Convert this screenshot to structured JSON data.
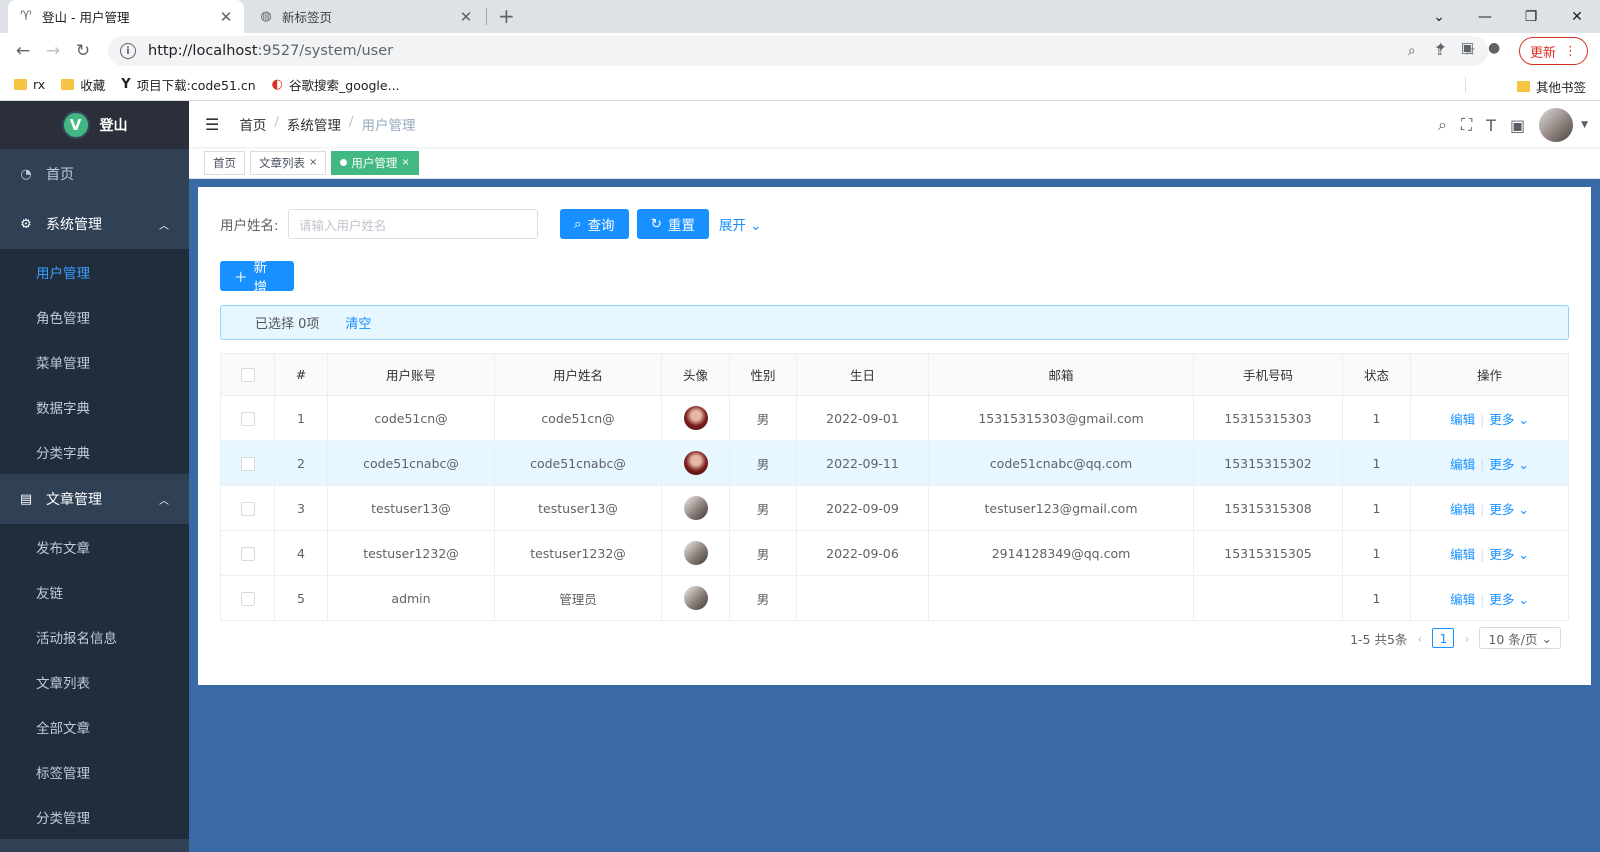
{
  "browser": {
    "tabs": [
      {
        "title": "登山 - 用户管理",
        "icon": "mountain-icon"
      },
      {
        "title": "新标签页",
        "icon": "globe-icon"
      }
    ],
    "url_host": "http://localhost",
    "url_path": ":9527/system/user",
    "update_label": "更新",
    "bookmarks": [
      "rx",
      "收藏",
      "项目下载:code51.cn",
      "谷歌搜索_google..."
    ],
    "other_bookmarks": "其他书签"
  },
  "sidebar": {
    "logo_letter": "V",
    "logo_text": "登山",
    "items": [
      {
        "label": "首页",
        "icon": "dashboard-icon"
      },
      {
        "label": "系统管理",
        "icon": "gear-icon",
        "children": [
          "用户管理",
          "角色管理",
          "菜单管理",
          "数据字典",
          "分类字典"
        ]
      },
      {
        "label": "文章管理",
        "icon": "document-icon",
        "children": [
          "发布文章",
          "友链",
          "活动报名信息",
          "文章列表",
          "全部文章",
          "标签管理",
          "分类管理"
        ]
      }
    ]
  },
  "breadcrumb": [
    "首页",
    "系统管理",
    "用户管理"
  ],
  "tags": [
    "首页",
    "文章列表",
    "用户管理"
  ],
  "search": {
    "label": "用户姓名:",
    "placeholder": "请输入用户姓名",
    "query": "查询",
    "reset": "重置",
    "expand": "展开"
  },
  "add_label": "新增",
  "alert": {
    "selected": "已选择 0项",
    "clear": "清空"
  },
  "table": {
    "columns": [
      "#",
      "用户账号",
      "用户姓名",
      "头像",
      "性别",
      "生日",
      "邮箱",
      "手机号码",
      "状态",
      "操作"
    ],
    "rows": [
      {
        "no": "1",
        "account": "code51cn@",
        "name": "code51cn@",
        "gender": "男",
        "birthday": "2022-09-01",
        "email": "15315315303@gmail.com",
        "phone": "15315315303",
        "status": "1"
      },
      {
        "no": "2",
        "account": "code51cnabc@",
        "name": "code51cnabc@",
        "gender": "男",
        "birthday": "2022-09-11",
        "email": "code51cnabc@qq.com",
        "phone": "15315315302",
        "status": "1"
      },
      {
        "no": "3",
        "account": "testuser13@",
        "name": "testuser13@",
        "gender": "男",
        "birthday": "2022-09-09",
        "email": "testuser123@gmail.com",
        "phone": "15315315308",
        "status": "1"
      },
      {
        "no": "4",
        "account": "testuser1232@",
        "name": "testuser1232@",
        "gender": "男",
        "birthday": "2022-09-06",
        "email": "2914128349@qq.com",
        "phone": "15315315305",
        "status": "1"
      },
      {
        "no": "5",
        "account": "admin",
        "name": "管理员",
        "gender": "男",
        "birthday": "",
        "email": "",
        "phone": "",
        "status": "1"
      }
    ],
    "edit": "编辑",
    "more": "更多"
  },
  "pagination": {
    "summary": "1-5 共5条",
    "page": "1",
    "size": "10 条/页"
  }
}
